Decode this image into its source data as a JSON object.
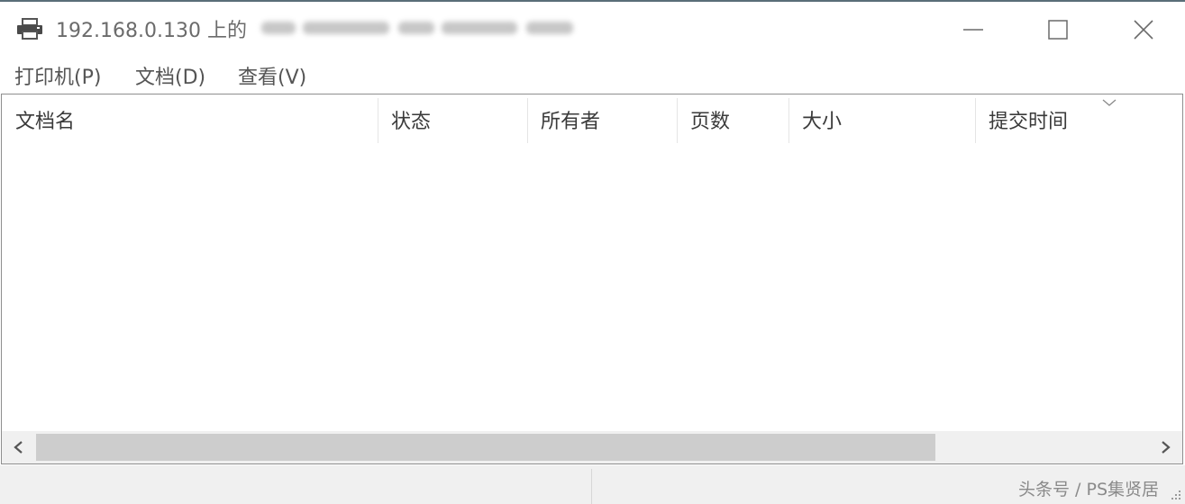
{
  "window": {
    "title": "192.168.0.130 上的",
    "printer_icon": "printer-icon",
    "controls": {
      "minimize_icon": "minimize-icon",
      "maximize_icon": "maximize-icon",
      "close_icon": "close-icon"
    }
  },
  "menu": {
    "items": [
      {
        "label": "打印机(P)"
      },
      {
        "label": "文档(D)"
      },
      {
        "label": "查看(V)"
      }
    ]
  },
  "list": {
    "columns": [
      {
        "label": "文档名"
      },
      {
        "label": "状态"
      },
      {
        "label": "所有者"
      },
      {
        "label": "页数"
      },
      {
        "label": "大小"
      },
      {
        "label": "提交时间"
      }
    ],
    "sort_icon": "chevron-down-icon",
    "rows": []
  },
  "scrollbar": {
    "left_icon": "chevron-left-icon",
    "right_icon": "chevron-right-icon"
  },
  "statusbar": {
    "watermark": "头条号 / PS集贤居"
  },
  "colors": {
    "title_text": "#6b6b6b",
    "border": "#8e8e8e",
    "scroll_thumb": "#cdcdcd",
    "status_bg": "#f0f0f0"
  }
}
